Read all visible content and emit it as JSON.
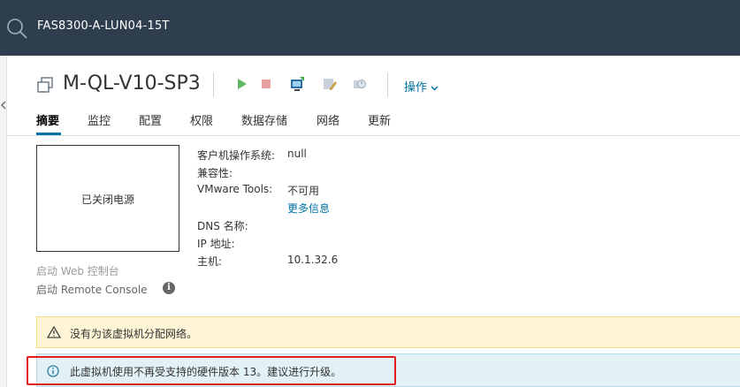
{
  "topbar": {
    "search_text": "FAS8300-A-LUN04-15T"
  },
  "header": {
    "vm_name": "M-QL-V10-SP3",
    "actions_label": "操作"
  },
  "toolbar_icons": [
    "power-on-icon",
    "power-off-icon",
    "launch-console-icon",
    "edit-settings-icon",
    "snapshot-icon"
  ],
  "tabs": [
    {
      "label": "摘要",
      "active": true
    },
    {
      "label": "监控"
    },
    {
      "label": "配置"
    },
    {
      "label": "权限"
    },
    {
      "label": "数据存储"
    },
    {
      "label": "网络"
    },
    {
      "label": "更新"
    }
  ],
  "console": {
    "power_state": "已关闭电源",
    "launch_web": "启动 Web 控制台",
    "launch_remote": "启动 Remote Console"
  },
  "details": {
    "guest_os_label": "客户机操作系统:",
    "guest_os_value": "null",
    "compat_label": "兼容性:",
    "vmtools_label": "VMware Tools:",
    "vmtools_value": "不可用",
    "more_info": "更多信息",
    "dns_label": "DNS 名称:",
    "ip_label": "IP 地址:",
    "host_label": "主机:",
    "host_value": "10.1.32.6"
  },
  "alerts": {
    "warning_text": "没有为该虚拟机分配网络。",
    "info_text": "此虚拟机使用不再受支持的硬件版本 13。建议进行升级。"
  },
  "colors": {
    "topbar": "#2e3e4e",
    "accent": "#0072a3",
    "warning_bg": "#fdf5d5",
    "info_bg": "#e1f1f6",
    "highlight": "#e02020"
  }
}
